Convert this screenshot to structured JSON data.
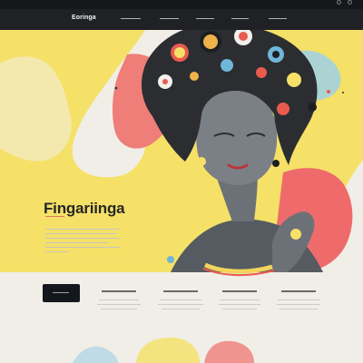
{
  "header": {
    "brand": "Eoringa",
    "nav_items": [
      "",
      "",
      "",
      "",
      ""
    ]
  },
  "hero": {
    "title": "Fingariinga",
    "illustration": "stylized-woman-portrait"
  },
  "cta": {
    "label": ""
  },
  "features": [
    {
      "title": ""
    },
    {
      "title": ""
    },
    {
      "title": ""
    },
    {
      "title": ""
    }
  ],
  "colors": {
    "header_bg": "#1f2124",
    "page_bg": "#f1eee7",
    "accent_yellow": "#f4df5d",
    "accent_coral": "#ef7d78",
    "accent_blue": "#6fb6d8",
    "text_dark": "#262626",
    "button_bg": "#14181c"
  }
}
